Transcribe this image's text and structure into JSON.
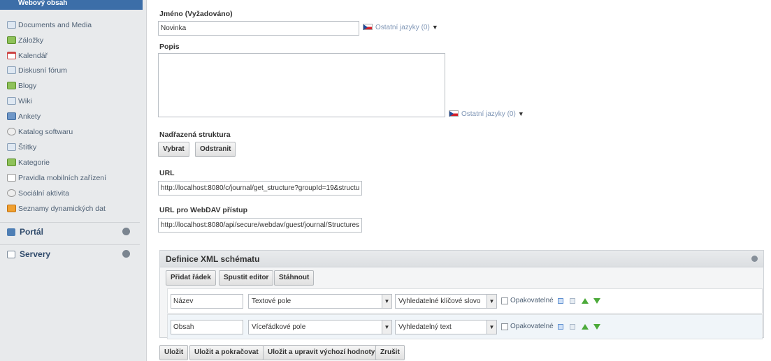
{
  "sidebar": {
    "active_item": "Webový obsah",
    "items": [
      {
        "label": "Documents and Media",
        "icon": "documents-icon"
      },
      {
        "label": "Záložky",
        "icon": "bookmarks-icon"
      },
      {
        "label": "Kalendář",
        "icon": "calendar-icon"
      },
      {
        "label": "Diskusní fórum",
        "icon": "forum-icon"
      },
      {
        "label": "Blogy",
        "icon": "blogs-icon"
      },
      {
        "label": "Wiki",
        "icon": "wiki-icon"
      },
      {
        "label": "Ankety",
        "icon": "polls-icon"
      },
      {
        "label": "Katalog softwaru",
        "icon": "software-catalog-icon"
      },
      {
        "label": "Štítky",
        "icon": "tags-icon"
      },
      {
        "label": "Kategorie",
        "icon": "categories-icon"
      },
      {
        "label": "Pravidla mobilních zařízení",
        "icon": "mobile-rules-icon"
      },
      {
        "label": "Sociální aktivita",
        "icon": "social-activity-icon"
      },
      {
        "label": "Seznamy dynamických dat",
        "icon": "dynamic-data-icon"
      }
    ],
    "sections": [
      {
        "label": "Portál",
        "icon": "portal-icon"
      },
      {
        "label": "Servery",
        "icon": "server-icon"
      }
    ]
  },
  "form": {
    "name_label": "Jméno (Vyžadováno)",
    "name_value": "Novinka",
    "other_languages": "Ostatní jazyky (0)",
    "description_label": "Popis",
    "parent_label": "Nadřazená struktura",
    "select_button": "Vybrat",
    "remove_button": "Odstranit",
    "url_label": "URL",
    "url_value": "http://localhost:8080/c/journal/get_structure?groupId=19&structu",
    "webdav_label": "URL pro WebDAV přístup",
    "webdav_value": "http://localhost:8080/api/secure/webdav/guest/journal/Structures"
  },
  "xml_panel": {
    "title": "Definice XML schématu",
    "buttons": {
      "add_row": "Přidat řádek",
      "run_editor": "Spustit editor",
      "download": "Stáhnout"
    },
    "rows": [
      {
        "name": "Název",
        "type": "Textové pole",
        "index": "Vyhledatelné klíčové slovo",
        "repeatable": "Opakovatelné"
      },
      {
        "name": "Obsah",
        "type": "Víceřádkové pole",
        "index": "Vyhledatelný text",
        "repeatable": "Opakovatelné"
      }
    ]
  },
  "footer": {
    "save": "Uložit",
    "save_continue": "Uložit a pokračovat",
    "save_edit_defaults": "Uložit a upravit výchozí hodnoty",
    "cancel": "Zrušit"
  }
}
